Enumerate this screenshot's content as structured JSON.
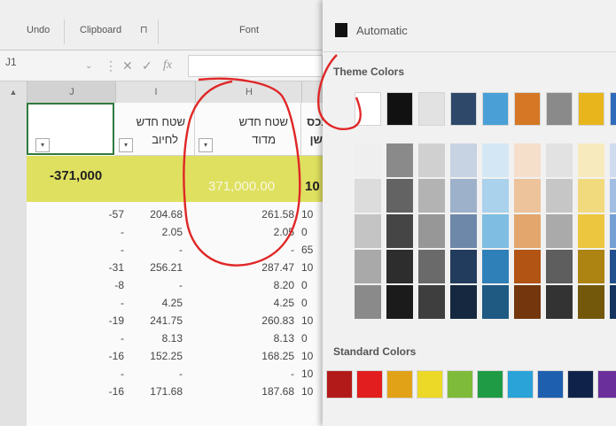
{
  "ribbon": {
    "undo": "Undo",
    "clipboard": "Clipboard",
    "clipboard_launcher": "⊓",
    "font": "Font"
  },
  "formula_bar": {
    "name_box": "J1",
    "fx": "fx"
  },
  "columns": {
    "j": "J",
    "i": "I",
    "h": "H"
  },
  "headers": {
    "j": "",
    "i_line1": "שטח חדש",
    "i_line2": "לחיוב",
    "h_line1": "שטח חדש",
    "h_line2": "מדוד",
    "k_line1": "נכס",
    "k_line2": "שן"
  },
  "totals": {
    "j": "-371,000",
    "h": "371,000.00",
    "k": "10"
  },
  "rows": [
    {
      "j": "-57",
      "i": "204.68",
      "h": "261.58",
      "k": "10"
    },
    {
      "j": "-",
      "i": "2.05",
      "h": "2.05",
      "k": "0"
    },
    {
      "j": "-",
      "i": "-",
      "h": "-",
      "k": "65"
    },
    {
      "j": "-31",
      "i": "256.21",
      "h": "287.47",
      "k": "10"
    },
    {
      "j": "-8",
      "i": "-",
      "h": "8.20",
      "k": "0"
    },
    {
      "j": "-",
      "i": "4.25",
      "h": "4.25",
      "k": "0"
    },
    {
      "j": "-19",
      "i": "241.75",
      "h": "260.83",
      "k": "10"
    },
    {
      "j": "-",
      "i": "8.13",
      "h": "8.13",
      "k": "0"
    },
    {
      "j": "-16",
      "i": "152.25",
      "h": "168.25",
      "k": "10"
    },
    {
      "j": "-",
      "i": "-",
      "h": "-",
      "k": "10"
    },
    {
      "j": "-16",
      "i": "171.68",
      "h": "187.68",
      "k": "10"
    }
  ],
  "palette": {
    "automatic": "Automatic",
    "theme_title": "Theme Colors",
    "standard_title": "Standard Colors",
    "theme_colors": [
      "#ffffff",
      "#111111",
      "#e2e2e2",
      "#2d4869",
      "#4aa0d6",
      "#d57724",
      "#8a8a8a",
      "#e8b61c",
      "#2f6bbb",
      "#4f9a3a"
    ],
    "shades": [
      [
        "#efefef",
        "#dcdcdc",
        "#c4c4c4",
        "#a9a9a9",
        "#8a8a8a"
      ],
      [
        "#8a8a8a",
        "#636363",
        "#454545",
        "#2d2d2d",
        "#1b1b1b"
      ],
      [
        "#d0d0d0",
        "#b3b3b3",
        "#979797",
        "#6a6a6a",
        "#3e3e3e"
      ],
      [
        "#c7d2e2",
        "#9db1cb",
        "#6e88aa",
        "#223c5e",
        "#16283f"
      ],
      [
        "#d4e7f4",
        "#aad2ec",
        "#7fbde3",
        "#2f80b8",
        "#1e5a82"
      ],
      [
        "#f5dfcb",
        "#ecc39b",
        "#e3a66d",
        "#b25413",
        "#74360c"
      ],
      [
        "#e2e2e2",
        "#c6c6c6",
        "#aaaaaa",
        "#5e5e5e",
        "#333333"
      ],
      [
        "#f7ebbd",
        "#f1d97d",
        "#ebc63e",
        "#ad8412",
        "#73580c"
      ],
      [
        "#cfdcf0",
        "#a2bee3",
        "#74a0d6",
        "#21508f",
        "#15345f"
      ],
      [
        "#d6e8cf",
        "#aed3a0",
        "#86be70",
        "#3a7428",
        "#264c1a"
      ]
    ],
    "standard_colors": [
      "#b21a1a",
      "#e21e1e",
      "#e2a218",
      "#ecd826",
      "#7fbb3a",
      "#1f9a45",
      "#29a3d8",
      "#1f5fb0",
      "#0f234a",
      "#6a2f9a"
    ]
  }
}
